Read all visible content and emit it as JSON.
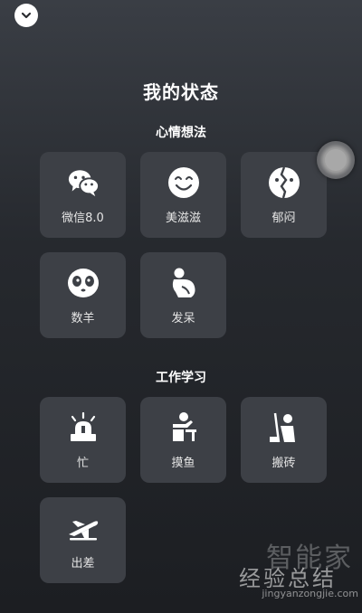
{
  "header": {
    "title": "我的状态",
    "collapse_icon": "chevron-down-icon"
  },
  "sections": [
    {
      "title": "心情想法",
      "items": [
        {
          "label": "微信8.0",
          "icon": "wechat-icon"
        },
        {
          "label": "美滋滋",
          "icon": "smile-face-icon"
        },
        {
          "label": "郁闷",
          "icon": "broken-face-icon"
        },
        {
          "label": "数羊",
          "icon": "sheep-icon"
        },
        {
          "label": "发呆",
          "icon": "daze-person-icon"
        }
      ]
    },
    {
      "title": "工作学习",
      "items": [
        {
          "label": "忙",
          "icon": "alarm-light-icon"
        },
        {
          "label": "摸鱼",
          "icon": "desk-person-icon"
        },
        {
          "label": "搬砖",
          "icon": "worker-icon"
        },
        {
          "label": "出差",
          "icon": "airplane-icon"
        }
      ]
    }
  ],
  "watermark": {
    "logo_text": "智能家",
    "overlay_text": "经验总结",
    "url": "jingyanzongjie.com"
  },
  "colors": {
    "background": "#26292e",
    "tile": "#3d4046",
    "text": "#ffffff"
  }
}
